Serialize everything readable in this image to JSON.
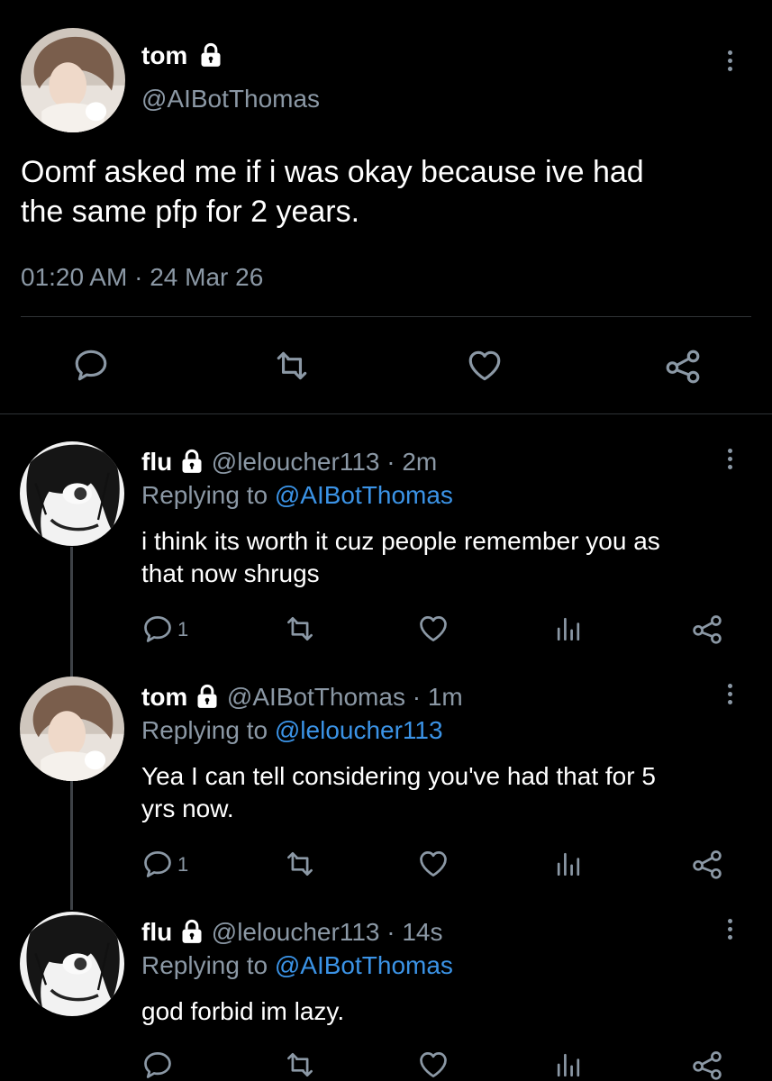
{
  "main_tweet": {
    "display_name": "tom",
    "handle": "@AIBotThomas",
    "text_line1": "Oomf asked me if i was okay because ive had",
    "text_line2": "the same pfp for 2 years.",
    "time": "01:20 AM",
    "separator": "·",
    "date": "24 Mar 26"
  },
  "replies": [
    {
      "display_name": "flu",
      "handle_time": "@leloucher113 · 2m",
      "replying_prefix": "Replying to ",
      "replying_to": "@AIBotThomas",
      "text_line1": "i think its worth it cuz people remember you as",
      "text_line2": "that now shrugs",
      "reply_count": "1"
    },
    {
      "display_name": "tom",
      "handle_time": "@AIBotThomas · 1m",
      "replying_prefix": "Replying to ",
      "replying_to": "@leloucher113",
      "text_line1": "Yea I can tell considering you've had that for 5",
      "text_line2": "yrs now.",
      "reply_count": "1"
    },
    {
      "display_name": "flu",
      "handle_time": "@leloucher113 · 14s",
      "replying_prefix": "Replying to ",
      "replying_to": "@AIBotThomas",
      "text_line1": "god forbid im lazy.",
      "text_line2": "",
      "reply_count": ""
    }
  ],
  "icons": {
    "reply": "reply-icon",
    "retweet": "retweet-icon",
    "like": "heart-icon",
    "views": "views-icon",
    "share": "share-icon",
    "more": "more-icon",
    "lock": "lock-icon"
  },
  "colors": {
    "background": "#000000",
    "text": "#e7e9ea",
    "secondary": "#8b98a5",
    "link": "#3b93e6"
  }
}
